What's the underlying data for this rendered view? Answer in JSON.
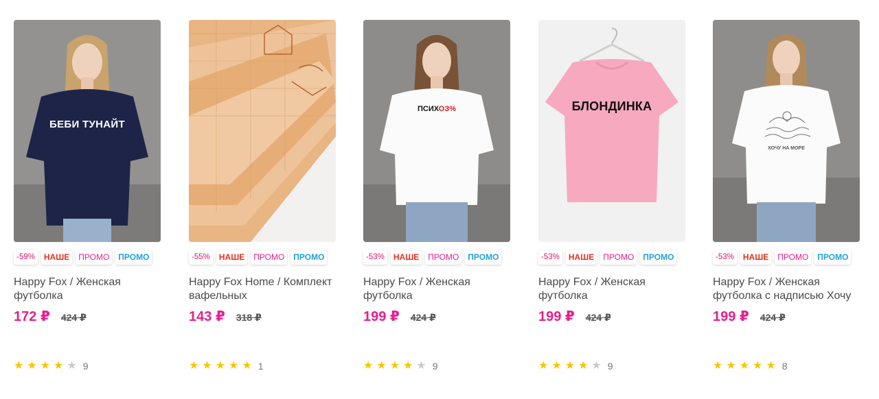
{
  "colors": {
    "accent_price": "#e91e8c",
    "star_on": "#f7c600",
    "star_off": "#c9c9c9",
    "badge_nashe": "#e5311d",
    "badge_promo_blue": "#1fa3d9"
  },
  "products": [
    {
      "discount": "-59%",
      "badge_nashe": "НАШЕ",
      "badge_promo_1": "ПРОМО",
      "badge_promo_2": "ПРОМО",
      "title": "Happy Fox / Женская футболка",
      "price": "172 ₽",
      "old_price": "424 ₽",
      "rating": 4,
      "reviews": "9",
      "print_text": "БЕБИ ТУНАЙТ",
      "image": "woman-navy-tshirt"
    },
    {
      "discount": "-55%",
      "badge_nashe": "НАШЕ",
      "badge_promo_1": "ПРОМО",
      "badge_promo_2": "ПРОМО",
      "title": "Happy Fox Home / Комплект вафельных",
      "price": "143 ₽",
      "old_price": "318 ₽",
      "rating": 5,
      "reviews": "1",
      "image": "waffle-towels"
    },
    {
      "discount": "-53%",
      "badge_nashe": "НАШЕ",
      "badge_promo_1": "ПРОМО",
      "badge_promo_2": "ПРОМО",
      "title": "Happy Fox / Женская футболка",
      "price": "199 ₽",
      "old_price": "424 ₽",
      "rating": 4,
      "reviews": "9",
      "print_text_a": "ПСИХ",
      "print_text_b": "ОЗ%",
      "image": "woman-white-tshirt"
    },
    {
      "discount": "-53%",
      "badge_nashe": "НАШЕ",
      "badge_promo_1": "ПРОМО",
      "badge_promo_2": "ПРОМО",
      "title": "Happy Fox / Женская футболка",
      "price": "199 ₽",
      "old_price": "424 ₽",
      "rating": 4,
      "reviews": "9",
      "print_text": "БЛОНДИНКА",
      "image": "pink-tshirt-on-hanger"
    },
    {
      "discount": "-53%",
      "badge_nashe": "НАШЕ",
      "badge_promo_1": "ПРОМО",
      "badge_promo_2": "ПРОМО",
      "title": "Happy Fox / Женская футболка с надписью Хочу",
      "price": "199 ₽",
      "old_price": "424 ₽",
      "rating": 5,
      "reviews": "8",
      "print_text": "ХОЧУ НА МОРЕ",
      "image": "woman-white-tshirt-sea"
    }
  ]
}
